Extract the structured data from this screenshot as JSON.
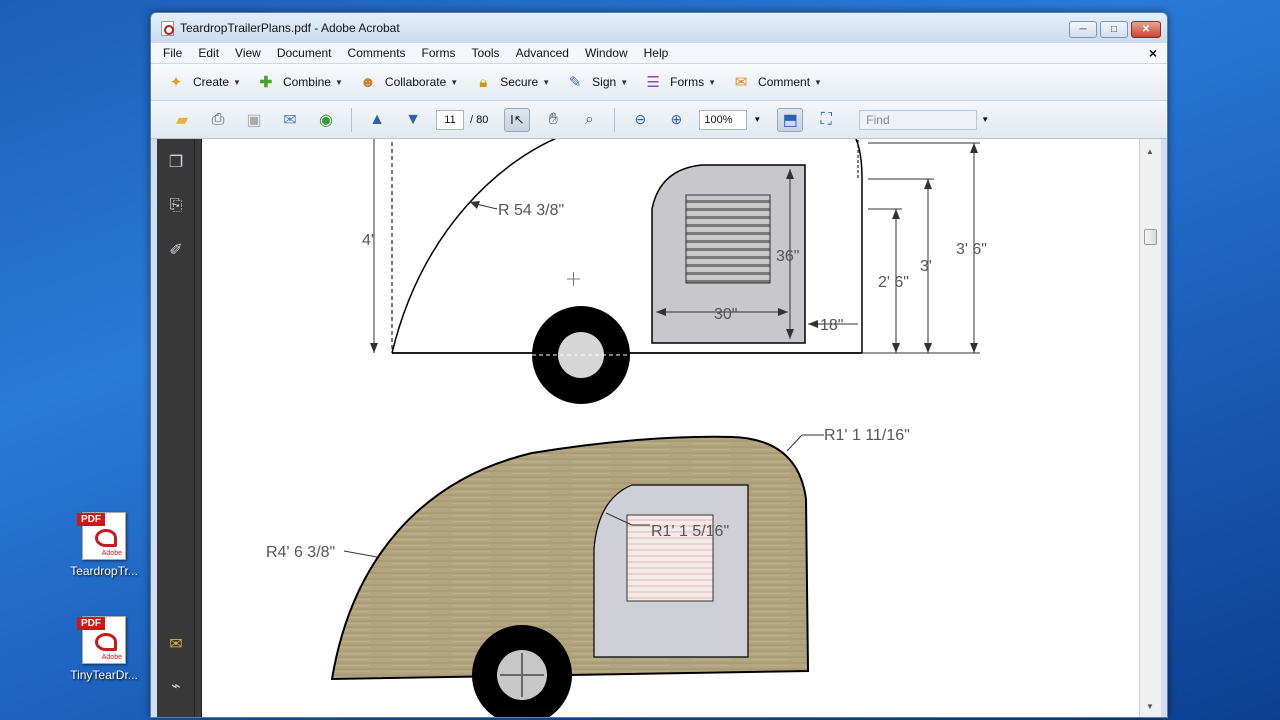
{
  "desktop": {
    "icons": [
      {
        "label": "TeardropTr...",
        "badge": "PDF",
        "brand": "Adobe"
      },
      {
        "label": "TinyTearDr...",
        "badge": "PDF",
        "brand": "Adobe"
      }
    ]
  },
  "window": {
    "title": "TeardropTrailerPlans.pdf - Adobe Acrobat",
    "minimize": "─",
    "maximize": "□",
    "close": "✕"
  },
  "menu": {
    "items": [
      "File",
      "Edit",
      "View",
      "Document",
      "Comments",
      "Forms",
      "Tools",
      "Advanced",
      "Window",
      "Help"
    ],
    "doc_close": "×"
  },
  "tasks_toolbar": {
    "items": [
      {
        "label": "Create",
        "icon": "create-icon",
        "color": "#e0a21a"
      },
      {
        "label": "Combine",
        "icon": "combine-icon",
        "color": "#4aa02c"
      },
      {
        "label": "Collaborate",
        "icon": "collaborate-icon",
        "color": "#d07a2a"
      },
      {
        "label": "Secure",
        "icon": "lock-icon",
        "color": "#c99a12"
      },
      {
        "label": "Sign",
        "icon": "pen-icon",
        "color": "#3b6fb5"
      },
      {
        "label": "Forms",
        "icon": "forms-icon",
        "color": "#8a4aa8"
      },
      {
        "label": "Comment",
        "icon": "comment-icon",
        "color": "#e08c1a"
      }
    ]
  },
  "nav_toolbar": {
    "current_page": "11",
    "total_pages": "/ 80",
    "zoom": "100%",
    "find_placeholder": "Find"
  },
  "document": {
    "top_view_labels": {
      "height_left": "4'",
      "radius": "R 54 3/8\"",
      "door_height": "36\"",
      "door_width": "30\"",
      "rear_offset": "18\"",
      "dim_2_6": "2' 6\"",
      "dim_3": "3'",
      "dim_3_6": "3' 6\""
    },
    "bottom_view_labels": {
      "rear_radius": "R1' 1 11/16\"",
      "door_radius": "R1' 1 5/16\"",
      "front_radius": "R4' 6 3/8\""
    }
  }
}
